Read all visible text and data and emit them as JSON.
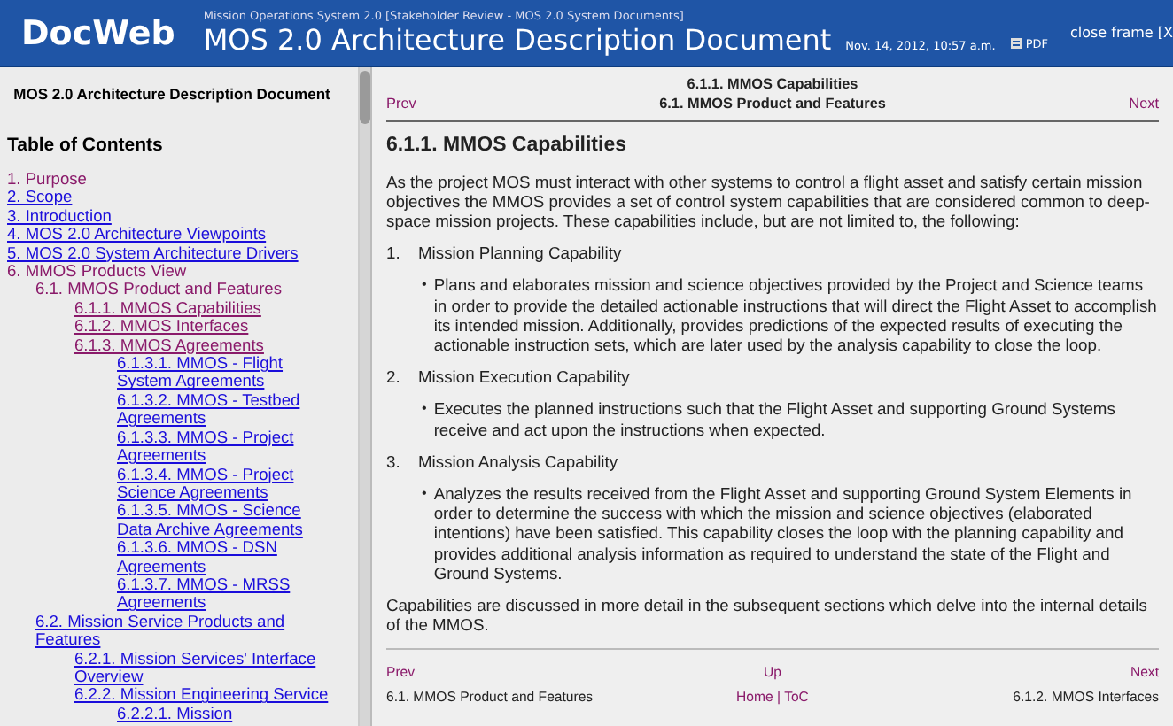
{
  "header": {
    "logo": "DocWeb",
    "subtitle": "Mission Operations System 2.0 [Stakeholder Review - MOS 2.0 System Documents]",
    "title": "MOS 2.0 Architecture Description Document",
    "date": "Nov. 14, 2012, 10:57 a.m.",
    "pdf": "PDF",
    "close": "close frame [X"
  },
  "sidebar": {
    "doc_title": "MOS 2.0 Architecture Description Document",
    "toc_heading": "Table of Contents",
    "items": [
      {
        "label": "1. Purpose",
        "kind": "text",
        "visited": true
      },
      {
        "label": "2. Scope",
        "kind": "link",
        "visited": false
      },
      {
        "label": "3. Introduction",
        "kind": "link",
        "visited": false
      },
      {
        "label": "4. MOS 2.0 Architecture Viewpoints",
        "kind": "link",
        "visited": false
      },
      {
        "label": "5. MOS 2.0 System Architecture Drivers",
        "kind": "link",
        "visited": false
      },
      {
        "label": "6. MMOS Products View",
        "kind": "text",
        "visited": true,
        "children": [
          {
            "label": "6.1. MMOS Product and Features",
            "kind": "text",
            "visited": true,
            "children": [
              {
                "label": "6.1.1. MMOS Capabilities",
                "kind": "link",
                "visited": true
              },
              {
                "label": "6.1.2. MMOS Interfaces",
                "kind": "link",
                "visited": true
              },
              {
                "label": "6.1.3. MMOS Agreements",
                "kind": "link",
                "visited": true,
                "children": [
                  {
                    "label": "6.1.3.1. MMOS - Flight System Agreements",
                    "kind": "link",
                    "visited": false
                  },
                  {
                    "label": "6.1.3.2. MMOS - Testbed Agreements",
                    "kind": "link",
                    "visited": false
                  },
                  {
                    "label": "6.1.3.3. MMOS - Project Agreements",
                    "kind": "link",
                    "visited": false
                  },
                  {
                    "label": "6.1.3.4. MMOS - Project Science Agreements",
                    "kind": "link",
                    "visited": false
                  },
                  {
                    "label": "6.1.3.5. MMOS - Science Data Archive Agreements",
                    "kind": "link",
                    "visited": false
                  },
                  {
                    "label": "6.1.3.6. MMOS - DSN Agreements",
                    "kind": "link",
                    "visited": false
                  },
                  {
                    "label": "6.1.3.7. MMOS - MRSS Agreements",
                    "kind": "link",
                    "visited": false
                  }
                ]
              }
            ]
          },
          {
            "label": "6.2. Mission Service Products and Features",
            "kind": "link",
            "visited": false,
            "children": [
              {
                "label": "6.2.1. Mission Services' Interface Overview",
                "kind": "link",
                "visited": false
              },
              {
                "label": "6.2.2. Mission Engineering Service",
                "kind": "link",
                "visited": false,
                "children": [
                  {
                    "label": "6.2.2.1. Mission",
                    "kind": "link",
                    "visited": false
                  }
                ]
              }
            ]
          }
        ]
      }
    ]
  },
  "top_nav": {
    "section": "6.1.1. MMOS Capabilities",
    "prev": "Prev",
    "parent": "6.1. MMOS Product and Features",
    "next": "Next"
  },
  "content": {
    "heading": "6.1.1. MMOS Capabilities",
    "intro": "As the project MOS must interact with other systems to control a flight asset and satisfy certain mission objectives the MMOS provides a set of control system capabilities that are considered common to deep-space mission projects. These capabilities include, but are not limited to, the following:",
    "capabilities": [
      {
        "number": "1.",
        "name": "Mission Planning Capability",
        "bullets": [
          {
            "marker": "•",
            "text": "Plans and elaborates mission and science objectives provided by the Project and Science teams in order to provide the detailed actionable instructions that will direct the Flight Asset to accomplish its intended mission. Additionally, provides predictions of the expected results of executing the actionable instruction sets, which are later used by the analysis capability to close the loop."
          }
        ]
      },
      {
        "number": "2.",
        "name": "Mission Execution Capability",
        "bullets": [
          {
            "marker": "•",
            "text": "Executes the planned instructions such that the Flight Asset and supporting Ground Systems receive and act upon the instructions when expected."
          }
        ]
      },
      {
        "number": "3.",
        "name": "Mission Analysis Capability",
        "bullets": [
          {
            "marker": "•",
            "text": "Analyzes the results received from the Flight Asset and supporting Ground System Elements in order to determine the success with which the mission and science objectives (elaborated intentions) have been satisfied. This capability closes the loop with the planning capability and provides additional analysis information as required to understand the state of the Flight and Ground Systems."
          }
        ]
      }
    ],
    "closing": "Capabilities are discussed in more detail in the subsequent sections which delve into the internal details of the MMOS."
  },
  "bottom_nav": {
    "prev": "Prev",
    "up": "Up",
    "next": "Next",
    "prev_title": "6.1. MMOS Product and Features",
    "home": "Home",
    "separator": "|",
    "toc": "ToC",
    "next_title": "6.1.2. MMOS Interfaces"
  }
}
